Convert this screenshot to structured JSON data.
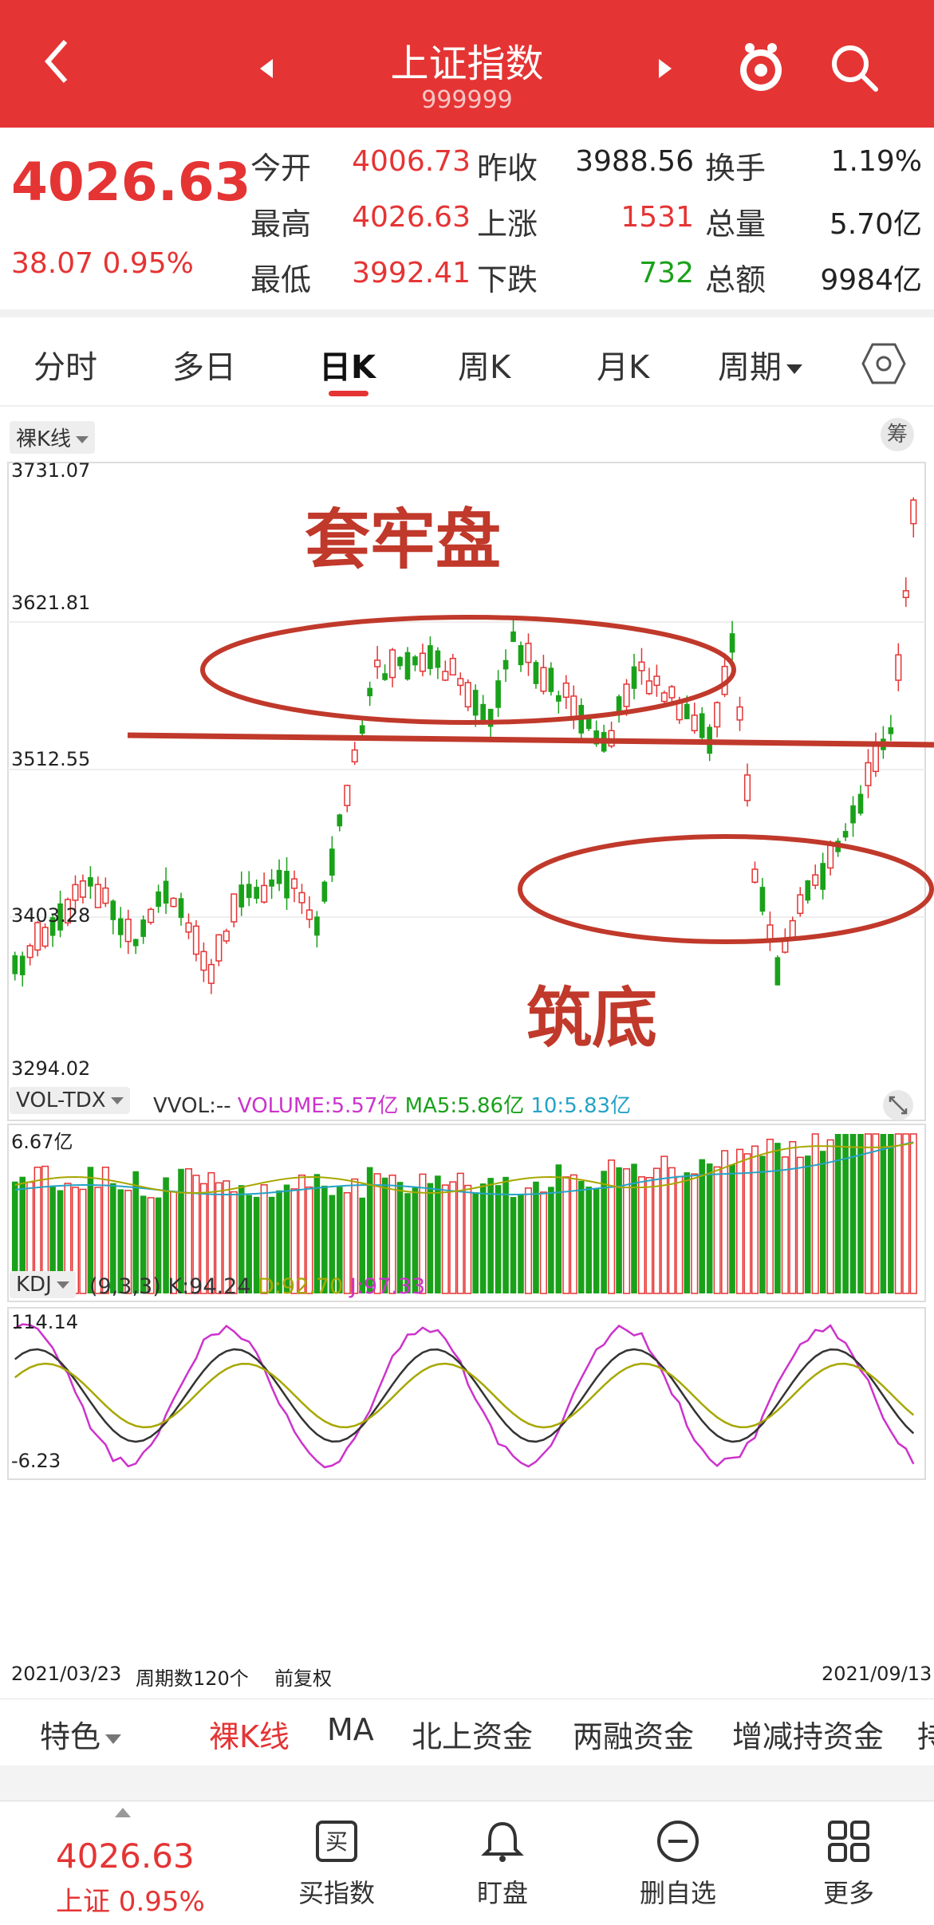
{
  "header": {
    "title": "上证指数",
    "code": "999999"
  },
  "quote": {
    "price": "4026.63",
    "change": "38.07 0.95%",
    "rows": [
      {
        "l1": "今开",
        "v1": "4006.73",
        "l2": "昨收",
        "v2": "3988.56",
        "l3": "换手",
        "v3": "1.19%"
      },
      {
        "l1": "最高",
        "v1": "4026.63",
        "l2": "上涨",
        "v2": "1531",
        "l3": "总量",
        "v3": "5.70亿"
      },
      {
        "l1": "最低",
        "v1": "3992.41",
        "l2": "下跌",
        "v2": "732",
        "l3": "总额",
        "v3": "9984亿"
      }
    ]
  },
  "tabs": [
    "分时",
    "多日",
    "日K",
    "周K",
    "月K",
    "周期"
  ],
  "chart": {
    "kline_label": "裸K线",
    "chip_label": "筹",
    "price_ticks": [
      "3731.07",
      "3621.81",
      "3512.55",
      "3403.28",
      "3294.02"
    ],
    "annotation_top": "套牢盘",
    "annotation_bottom": "筑底",
    "vol_label": "VOL-TDX",
    "vol_line": "VVOL:-- VOLUME:5.57亿 MA5:5.86亿 10:5.83亿",
    "vol_parts": {
      "vvol": "VVOL:--",
      "volume": "VOLUME:5.57亿",
      "ma5": "MA5:5.86亿",
      "ma10": "10:5.83亿"
    },
    "vol_top": "6.67亿",
    "kdj_label": "KDJ",
    "kdj_params": "(9,3,3)",
    "kdj_k": "K:94.24",
    "kdj_d": "D:92.70",
    "kdj_j": "J:97.33",
    "kdj_top": "114.14",
    "kdj_bottom": "-6.23",
    "date_start": "2021/03/23",
    "period_count": "周期数120个",
    "adjust": "前复权",
    "date_end": "2021/09/13"
  },
  "bottom_tabs": [
    "特色",
    "裸K线",
    "MA",
    "北上资金",
    "两融资金",
    "增减持资金",
    "持"
  ],
  "footer": {
    "price": "4026.63",
    "sub": "上证 0.95%",
    "items": [
      "买指数",
      "盯盘",
      "删自选",
      "更多"
    ]
  },
  "chart_data": {
    "type": "candlestick",
    "y_range": [
      3294.02,
      3731.07
    ],
    "x_range": [
      "2021/03/23",
      "2021/09/13"
    ],
    "last_close": 4026.63,
    "volume_latest": "5.57亿",
    "volume_ma5": "5.86亿",
    "volume_ma10": "5.83亿",
    "kdj": {
      "K": 94.24,
      "D": 92.7,
      "J": 97.33,
      "range": [
        -6.23,
        114.14
      ]
    }
  },
  "colors": {
    "brand": "#e53434",
    "up": "#e53434",
    "down": "#1aa11a",
    "magenta": "#cc33cc",
    "olive": "#a7a700",
    "cyan": "#25a3c7"
  }
}
